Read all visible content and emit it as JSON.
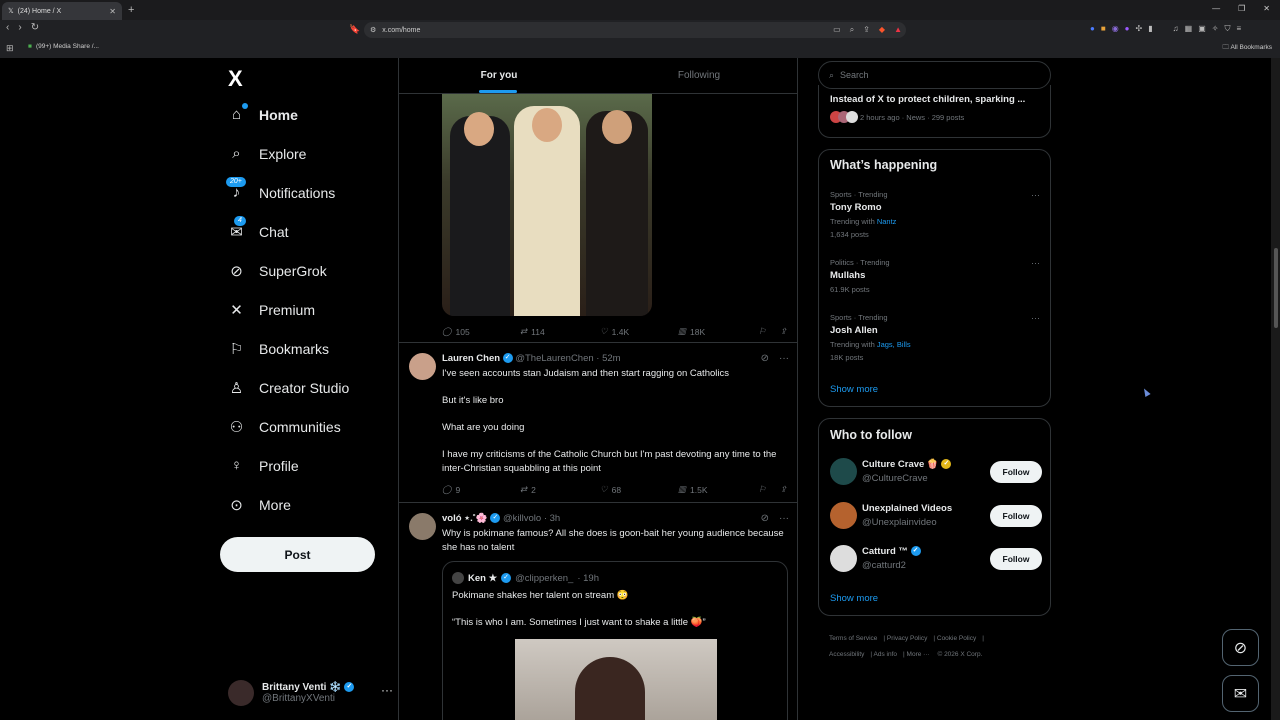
{
  "browser": {
    "tab_title": "(24) Home / X",
    "url": "x.com/home",
    "bookmark_item": "(99+) Media Share /...",
    "all_bookmarks": "All Bookmarks"
  },
  "sidebar": {
    "logo": "X",
    "items": [
      {
        "label": "Home",
        "icon": "home-icon"
      },
      {
        "label": "Explore",
        "icon": "search-icon"
      },
      {
        "label": "Notifications",
        "icon": "bell-icon",
        "badge": "20+"
      },
      {
        "label": "Chat",
        "icon": "envelope-icon",
        "badge": "4"
      },
      {
        "label": "SuperGrok",
        "icon": "grok-icon"
      },
      {
        "label": "Premium",
        "icon": "x-logo-icon"
      },
      {
        "label": "Bookmarks",
        "icon": "bookmark-icon"
      },
      {
        "label": "Creator Studio",
        "icon": "flask-icon"
      },
      {
        "label": "Communities",
        "icon": "people-icon"
      },
      {
        "label": "Profile",
        "icon": "person-icon"
      },
      {
        "label": "More",
        "icon": "more-circle-icon"
      }
    ],
    "post_label": "Post",
    "account": {
      "name": "Brittany Venti ❄️",
      "handle": "@BrittanyXVenti"
    }
  },
  "feed": {
    "tabs": [
      "For you",
      "Following"
    ],
    "tweet1_actions": {
      "replies": "105",
      "reposts": "114",
      "likes": "1.4K",
      "views": "18K"
    },
    "tweet2": {
      "name": "Lauren Chen",
      "handle": "@TheLaurenChen",
      "time": "· 52m",
      "lines": [
        "I've seen accounts stan Judaism and then start ragging on Catholics",
        "But it's like bro",
        "What are you doing",
        "I have my criticisms of the Catholic Church but I'm past devoting any time to the inter-Christian squabbling at this point"
      ],
      "actions": {
        "replies": "9",
        "reposts": "2",
        "likes": "68",
        "views": "1.5K"
      }
    },
    "tweet3": {
      "name": "voló ⋆.˚🌸",
      "handle": "@killvolo",
      "time": "· 3h",
      "text": "Why is pokimane famous? All she does is goon-bait her young audience because she has no talent",
      "quote": {
        "name": "Ken ★",
        "handle": "@clipperken_",
        "time": "· 19h",
        "line1": "Pokimane shakes her talent on stream 😳",
        "line2": "“This is who I am. Sometimes I just want to shake a little 🍑”"
      }
    }
  },
  "right": {
    "search_placeholder": "Search",
    "news": {
      "title": "Instead of X to protect children, sparking ...",
      "meta": "2 hours ago · News · 299 posts"
    },
    "happening": {
      "title": "What’s happening",
      "trends": [
        {
          "context": "Sports · Trending",
          "name": "Tony Romo",
          "with_label": "Trending with",
          "with": "Nantz",
          "posts": "1,634 posts"
        },
        {
          "context": "Politics · Trending",
          "name": "Mullahs",
          "posts": "61.9K posts"
        },
        {
          "context": "Sports · Trending",
          "name": "Josh Allen",
          "with_label": "Trending with",
          "with": "Jags, Bills",
          "posts": "18K posts"
        }
      ],
      "show_more": "Show more"
    },
    "who_to_follow": {
      "title": "Who to follow",
      "accounts": [
        {
          "name": "Culture Crave 🍿",
          "handle": "@CultureCrave",
          "button": "Follow"
        },
        {
          "name": "Unexplained Videos",
          "handle": "@Unexplainvideo",
          "button": "Follow"
        },
        {
          "name": "Catturd ™",
          "handle": "@catturd2",
          "button": "Follow"
        }
      ],
      "show_more": "Show more"
    },
    "footer": [
      "Terms of Service",
      "Privacy Policy",
      "Cookie Policy",
      "Accessibility",
      "Ads info",
      "More ···",
      "© 2026 X Corp."
    ]
  },
  "colors": {
    "accent": "#1d9bf0",
    "background": "#000000",
    "border": "#2f3336",
    "muted": "#71767b"
  }
}
